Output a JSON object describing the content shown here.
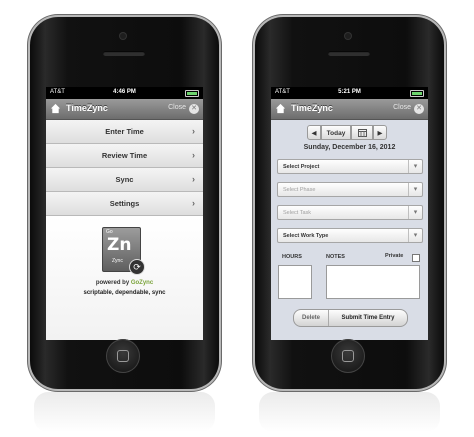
{
  "left_phone": {
    "status": {
      "carrier": "AT&T",
      "time": "4:46 PM"
    },
    "titlebar": {
      "title": "TimeZync",
      "close_label": "Close"
    },
    "menu": [
      {
        "label": "Enter Time"
      },
      {
        "label": "Review Time"
      },
      {
        "label": "Sync"
      },
      {
        "label": "Settings"
      }
    ],
    "logo": {
      "prefix": "Go",
      "symbol": "Zn",
      "name": "Zync"
    },
    "powered_by": "powered by",
    "powered_brand": "GoZync",
    "tagline": "scriptable, dependable, sync"
  },
  "right_phone": {
    "status": {
      "carrier": "AT&T",
      "time": "5:21 PM"
    },
    "titlebar": {
      "title": "TimeZync",
      "close_label": "Close"
    },
    "date_nav": {
      "today_label": "Today"
    },
    "date_label": "Sunday, December 16, 2012",
    "selects": [
      {
        "label": "Select Project",
        "dim": false
      },
      {
        "label": "Select Phase",
        "dim": true
      },
      {
        "label": "Select Task",
        "dim": true
      },
      {
        "label": "Select Work Type",
        "dim": false
      }
    ],
    "fields": {
      "hours_label": "HOURS",
      "notes_label": "NOTES",
      "private_label": "Private"
    },
    "actions": {
      "delete_label": "Delete",
      "submit_label": "Submit Time Entry"
    }
  },
  "colors": {
    "accent_green": "#7aa33a",
    "titlebar_gray": "#7f7f7f"
  }
}
